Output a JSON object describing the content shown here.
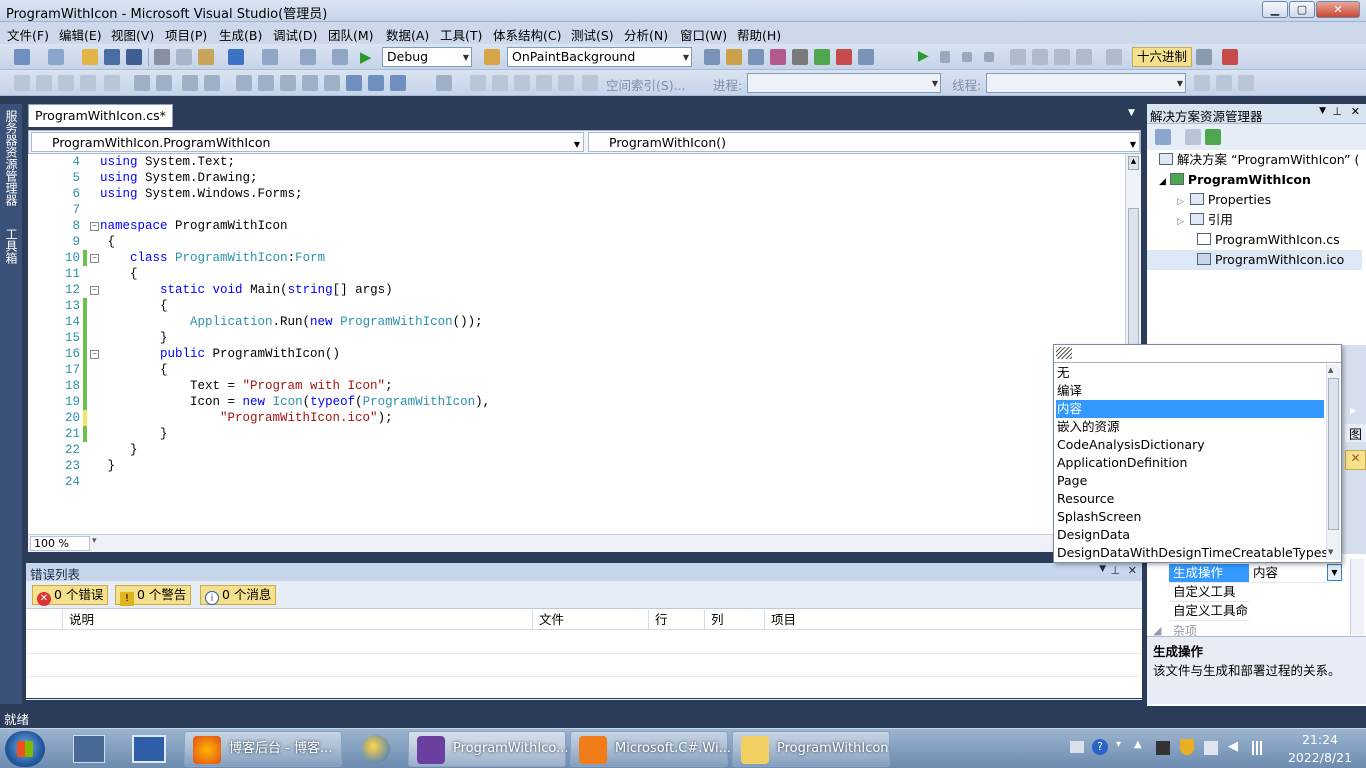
{
  "window": {
    "title": "ProgramWithIcon - Microsoft Visual Studio(管理员)",
    "min": "▁",
    "max": "▢",
    "close": "✕"
  },
  "menu": [
    "文件(F)",
    "编辑(E)",
    "视图(V)",
    "项目(P)",
    "生成(B)",
    "调试(D)",
    "团队(M)",
    "数据(A)",
    "工具(T)",
    "体系结构(C)",
    "测试(S)",
    "分析(N)",
    "窗口(W)",
    "帮助(H)"
  ],
  "toolbar": {
    "config": "Debug",
    "target": "OnPaintBackground",
    "hex": "十六进制",
    "index_label": "空间索引(S)...",
    "process_label": "进程:",
    "thread_label": "线程:"
  },
  "editor": {
    "tab": "ProgramWithIcon.cs*",
    "nav_left": "ProgramWithIcon.ProgramWithIcon",
    "nav_right": "ProgramWithIcon()",
    "zoom": "100 %",
    "lines": [
      "4",
      "5",
      "6",
      "7",
      "8",
      "9",
      "10",
      "11",
      "12",
      "13",
      "14",
      "15",
      "16",
      "17",
      "18",
      "19",
      "20",
      "21",
      "22",
      "23",
      "24"
    ]
  },
  "side_tabs": {
    "server": "服务器资源管理器",
    "toolbox": "工具箱"
  },
  "errors": {
    "title": "错误列表",
    "errors_label": "0 个错误",
    "warnings_label": "0 个警告",
    "messages_label": "0 个消息",
    "columns": [
      "说明",
      "文件",
      "行",
      "列",
      "项目"
    ]
  },
  "solution": {
    "title": "解决方案资源管理器",
    "items": [
      "解决方案 “ProgramWithIcon” (",
      "ProgramWithIcon",
      "Properties",
      "引用",
      "ProgramWithIcon.cs",
      "ProgramWithIcon.ico"
    ]
  },
  "properties": {
    "rows": [
      {
        "name": "生成操作",
        "value": "内容"
      },
      {
        "name": "自定义工具",
        "value": ""
      },
      {
        "name": "自定义工具命",
        "value": ""
      }
    ],
    "category": "杂项",
    "desc_title": "生成操作",
    "desc_text": "该文件与生成和部署过程的关系。",
    "fragment_tu": "图"
  },
  "dropdown": {
    "items": [
      "无",
      "编译",
      "内容",
      "嵌入的资源",
      "CodeAnalysisDictionary",
      "ApplicationDefinition",
      "Page",
      "Resource",
      "SplashScreen",
      "DesignData",
      "DesignDataWithDesignTimeCreatableTypes"
    ],
    "selected_index": 2
  },
  "status": "就绪",
  "taskbar": {
    "items": [
      "博客后台 - 博客...",
      "ProgramWithIco...",
      "Microsoft.C#.Wi...",
      "ProgramWithIcon"
    ],
    "time": "21:24",
    "date": "2022/8/21"
  }
}
